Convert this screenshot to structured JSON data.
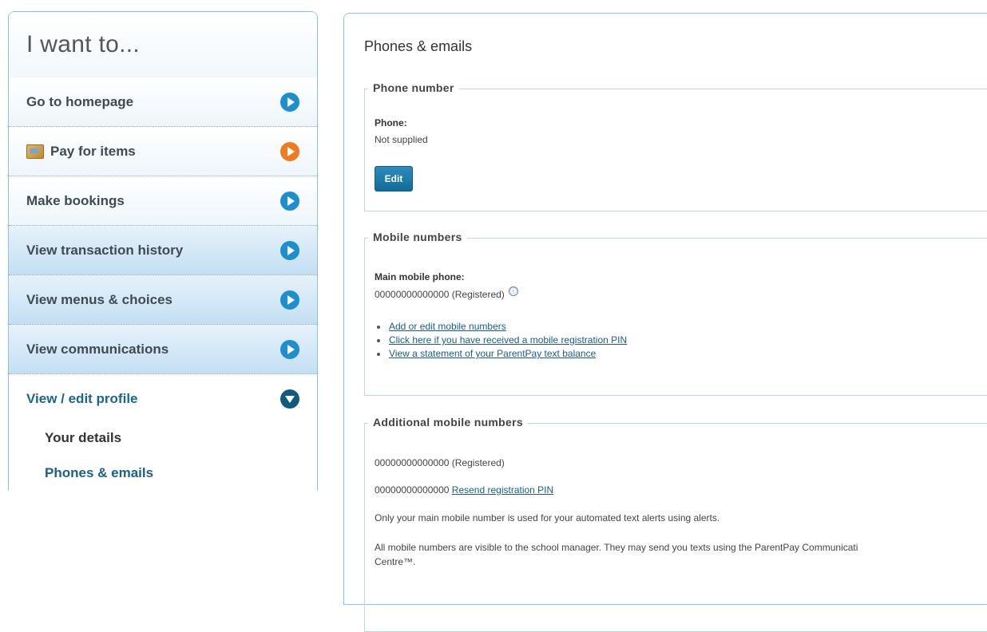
{
  "sidebar": {
    "title": "I want to...",
    "items": [
      {
        "label": "Go to homepage"
      },
      {
        "label": "Pay for items"
      },
      {
        "label": "Make bookings"
      },
      {
        "label": "View transaction history"
      },
      {
        "label": "View menus & choices"
      },
      {
        "label": "View communications"
      },
      {
        "label": "View / edit profile"
      }
    ],
    "subitems": [
      {
        "label": "Your details"
      },
      {
        "label": "Phones & emails"
      }
    ]
  },
  "main": {
    "title": "Phones & emails",
    "phone": {
      "legend": "Phone number",
      "label": "Phone:",
      "value": "Not supplied",
      "edit_label": "Edit"
    },
    "mobile": {
      "legend": "Mobile numbers",
      "label": "Main mobile phone:",
      "value": "00000000000000 (Registered)",
      "info_icon": "ⓘ",
      "links": [
        "Add or edit mobile numbers",
        "Click here if you have received a mobile registration PIN",
        "View a statement of your ParentPay text balance"
      ]
    },
    "additional": {
      "legend": "Additional mobile numbers",
      "number1": "00000000000000 (Registered)",
      "number2": "00000000000000",
      "resend_link": "Resend registration PIN",
      "note1": "Only your main mobile number is used for your automated text alerts using alerts.",
      "note2a": "All mobile numbers are visible to the school manager. They may send you texts using the ParentPay Communicati",
      "note2b": "Centre™."
    }
  },
  "colors": {
    "accent_blue": "#1d8fd0",
    "accent_orange": "#f07a1f",
    "border": "#8fc3da"
  }
}
